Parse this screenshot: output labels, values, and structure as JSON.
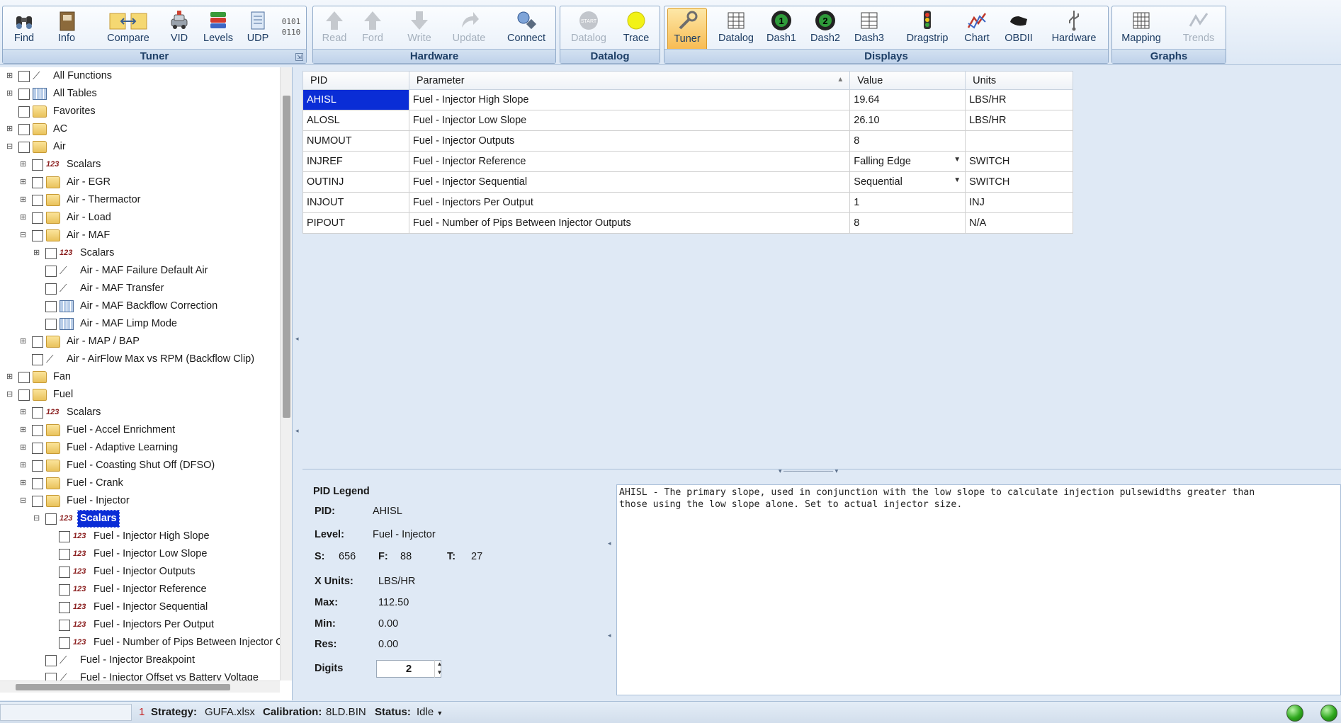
{
  "ribbon": {
    "groups": {
      "tuner": {
        "label": "Tuner",
        "buttons": {
          "find": "Find",
          "info": "Info",
          "compare": "Compare",
          "vid": "VID",
          "levels": "Levels",
          "udp": "UDP"
        }
      },
      "hardware": {
        "label": "Hardware",
        "buttons": {
          "read": "Read",
          "ford": "Ford",
          "write": "Write",
          "update": "Update",
          "connect": "Connect"
        }
      },
      "datalog": {
        "label": "Datalog",
        "buttons": {
          "datalog": "Datalog",
          "trace": "Trace"
        }
      },
      "displays": {
        "label": "Displays",
        "buttons": {
          "tuner": "Tuner",
          "datalog": "Datalog",
          "dash1": "Dash1",
          "dash2": "Dash2",
          "dash3": "Dash3",
          "dragstrip": "Dragstrip",
          "chart": "Chart",
          "obdii": "OBDII",
          "hardware": "Hardware"
        }
      },
      "graphs": {
        "label": "Graphs",
        "buttons": {
          "mapping": "Mapping",
          "trends": "Trends"
        }
      }
    },
    "udp_icon_text": "0101\n0110"
  },
  "tree": {
    "items": [
      {
        "label": "All Functions"
      },
      {
        "label": "All Tables"
      },
      {
        "label": "Favorites"
      },
      {
        "label": "AC"
      },
      {
        "label": "Air"
      },
      {
        "label": "Scalars"
      },
      {
        "label": "Air - EGR"
      },
      {
        "label": "Air - Thermactor"
      },
      {
        "label": "Air - Load"
      },
      {
        "label": "Air - MAF"
      },
      {
        "label": "Scalars"
      },
      {
        "label": "Air - MAF Failure Default Air"
      },
      {
        "label": "Air - MAF Transfer"
      },
      {
        "label": "Air - MAF Backflow Correction"
      },
      {
        "label": "Air - MAF Limp Mode"
      },
      {
        "label": "Air - MAP / BAP"
      },
      {
        "label": "Air - AirFlow Max vs RPM (Backflow Clip)"
      },
      {
        "label": "Fan"
      },
      {
        "label": "Fuel"
      },
      {
        "label": "Scalars"
      },
      {
        "label": "Fuel - Accel Enrichment"
      },
      {
        "label": "Fuel - Adaptive Learning"
      },
      {
        "label": "Fuel - Coasting Shut Off (DFSO)"
      },
      {
        "label": "Fuel - Crank"
      },
      {
        "label": "Fuel - Injector"
      },
      {
        "label": "Scalars"
      },
      {
        "label": "Fuel - Injector High Slope"
      },
      {
        "label": "Fuel - Injector Low Slope"
      },
      {
        "label": "Fuel - Injector Outputs"
      },
      {
        "label": "Fuel - Injector Reference"
      },
      {
        "label": "Fuel - Injector Sequential"
      },
      {
        "label": "Fuel - Injectors Per Output"
      },
      {
        "label": "Fuel - Number of Pips Between Injector C"
      },
      {
        "label": "Fuel - Injector Breakpoint"
      },
      {
        "label": "Fuel - Injector Offset vs Battery Voltage"
      }
    ]
  },
  "grid": {
    "headers": {
      "pid": "PID",
      "parameter": "Parameter",
      "value": "Value",
      "units": "Units"
    },
    "rows": [
      {
        "pid": "AHISL",
        "parameter": "Fuel - Injector High Slope",
        "value": "19.64",
        "units": "LBS/HR"
      },
      {
        "pid": "ALOSL",
        "parameter": "Fuel - Injector Low Slope",
        "value": "26.10",
        "units": "LBS/HR"
      },
      {
        "pid": "NUMOUT",
        "parameter": "Fuel - Injector Outputs",
        "value": "8",
        "units": ""
      },
      {
        "pid": "INJREF",
        "parameter": "Fuel - Injector Reference",
        "value": "Falling Edge",
        "units": "SWITCH"
      },
      {
        "pid": "OUTINJ",
        "parameter": "Fuel - Injector Sequential",
        "value": "Sequential",
        "units": "SWITCH"
      },
      {
        "pid": "INJOUT",
        "parameter": "Fuel - Injectors Per Output",
        "value": "1",
        "units": "INJ"
      },
      {
        "pid": "PIPOUT",
        "parameter": "Fuel - Number of Pips Between Injector Outputs",
        "value": "8",
        "units": "N/A"
      }
    ]
  },
  "legend": {
    "title": "PID Legend",
    "pid_label": "PID:",
    "pid_value": "AHISL",
    "level_label": "Level:",
    "level_value": "Fuel - Injector",
    "s_label": "S:",
    "s_value": "656",
    "f_label": "F:",
    "f_value": "88",
    "t_label": "T:",
    "t_value": "27",
    "xunits_label": "X Units:",
    "xunits_value": "LBS/HR",
    "max_label": "Max:",
    "max_value": "112.50",
    "min_label": "Min:",
    "min_value": "0.00",
    "res_label": "Res:",
    "res_value": "0.00",
    "digits_label": "Digits",
    "digits_value": "2"
  },
  "description": "AHISL - The primary slope, used in conjunction with the low slope to calculate injection pulsewidths greater than\nthose using the low slope alone. Set to actual injector size.",
  "status": {
    "index": "1",
    "strategy_label": "Strategy:",
    "strategy_value": "GUFA.xlsx",
    "calibration_label": "Calibration:",
    "calibration_value": "8LD.BIN",
    "status_label": "Status:",
    "status_value": "Idle"
  },
  "colors": {
    "selection": "#0a2dd6",
    "active_button": "#f7b94f",
    "ribbon_label": "#1e3f66",
    "led_green": "#2fa81e"
  }
}
